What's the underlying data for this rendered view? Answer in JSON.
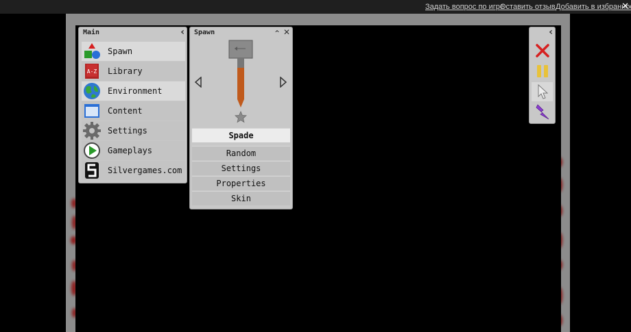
{
  "site_links": [
    {
      "label": "Задать вопрос по игре"
    },
    {
      "label": "Оставить отзыв"
    },
    {
      "label": "Добавить в избранное"
    }
  ],
  "close_glyph": "✕",
  "main_menu": {
    "title": "Main",
    "collapse_glyph": "‹",
    "items": [
      {
        "label": "Spawn",
        "icon": "spawn-shapes-icon"
      },
      {
        "label": "Library",
        "icon": "library-book-icon",
        "icon_text": "A-Z"
      },
      {
        "label": "Environment",
        "icon": "globe-icon"
      },
      {
        "label": "Content",
        "icon": "window-content-icon"
      },
      {
        "label": "Settings",
        "icon": "gear-icon"
      },
      {
        "label": "Gameplays",
        "icon": "play-icon"
      },
      {
        "label": "Silvergames.com",
        "icon": "silvergames-logo-icon"
      }
    ]
  },
  "spawn_panel": {
    "title": "Spawn",
    "minimize_glyph": "⌃",
    "close_glyph": "✕",
    "selected_item": "Spade",
    "buttons": [
      {
        "label": "Random"
      },
      {
        "label": "Settings"
      },
      {
        "label": "Properties"
      },
      {
        "label": "Skin"
      }
    ]
  },
  "tool_panel": {
    "collapse_glyph": "‹",
    "tools": [
      {
        "icon": "delete-x-icon"
      },
      {
        "icon": "pause-icon"
      },
      {
        "icon": "cursor-icon"
      },
      {
        "icon": "lightning-icon"
      }
    ]
  },
  "colors": {
    "accent_red": "#d62020",
    "pause_yellow": "#e8c23a",
    "lightning_purple": "#8a3ed0",
    "spade_handle": "#c05a1c",
    "blood": "#8e0a0a"
  }
}
